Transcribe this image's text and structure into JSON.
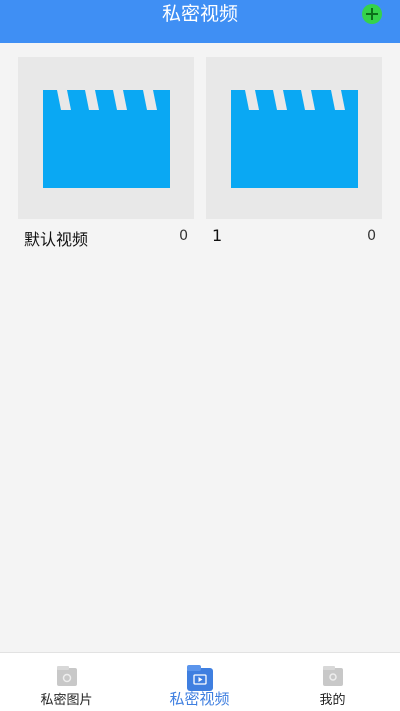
{
  "header": {
    "title": "私密视频"
  },
  "albums": [
    {
      "name": "默认视频",
      "count": "0",
      "icon": "clapperboard-icon"
    },
    {
      "name": "1",
      "count": "0",
      "icon": "clapperboard-icon"
    }
  ],
  "tabs": [
    {
      "label": "私密图片",
      "icon": "picture-folder-icon",
      "active": false
    },
    {
      "label": "私密视频",
      "icon": "video-folder-icon",
      "active": true
    },
    {
      "label": "我的",
      "icon": "profile-folder-icon",
      "active": false
    }
  ],
  "colors": {
    "header": "#3f8ff4",
    "accent_active": "#3f7fe0",
    "add_button": "#35d24a",
    "clapper": "#0aa8f3"
  }
}
